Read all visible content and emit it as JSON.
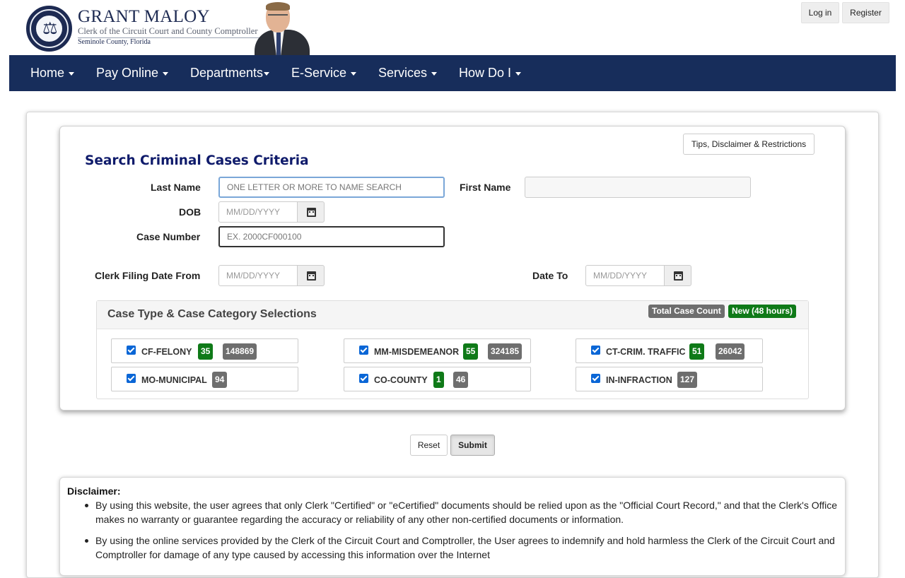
{
  "header": {
    "brand_name": "GRANT MALOY",
    "brand_subtitle": "Clerk of the Circuit Court and County Comptroller",
    "brand_county": "Seminole County, Florida",
    "login_label": "Log in",
    "register_label": "Register",
    "seal_icon": "county-seal-icon"
  },
  "nav": {
    "items": [
      {
        "label": "Home"
      },
      {
        "label": "Pay Online"
      },
      {
        "label": "Departments"
      },
      {
        "label": "E-Service"
      },
      {
        "label": "Services"
      },
      {
        "label": "How Do I"
      }
    ],
    "background": "#172d5b"
  },
  "form": {
    "tips_label": "Tips, Disclaimer & Restrictions",
    "title": "Search Criminal Cases Criteria",
    "last_name_label": "Last Name",
    "last_name_placeholder": "ONE LETTER OR MORE TO NAME SEARCH",
    "first_name_label": "First Name",
    "first_name_value": "",
    "dob_label": "DOB",
    "dob_placeholder": "MM/DD/YYYY",
    "case_number_label": "Case Number",
    "case_number_placeholder": "EX. 2000CF000100",
    "filing_from_label": "Clerk Filing Date From",
    "filing_from_placeholder": "MM/DD/YYYY",
    "date_to_label": "Date To",
    "date_to_placeholder": "MM/DD/YYYY",
    "title_color": "#0f1b6b"
  },
  "case_types": {
    "title": "Case Type & Case Category Selections",
    "total_badge": "Total Case Count",
    "new_badge": "New (48 hours)",
    "items": [
      {
        "label": "CF-FELONY",
        "checked": true,
        "new": "35",
        "total": "148869"
      },
      {
        "label": "MM-MISDEMEANOR",
        "checked": true,
        "new": "55",
        "total": "324185"
      },
      {
        "label": "CT-CRIM. TRAFFIC",
        "checked": true,
        "new": "51",
        "total": "26042"
      },
      {
        "label": "MO-MUNICIPAL",
        "checked": true,
        "new": "",
        "total": "94"
      },
      {
        "label": "CO-COUNTY",
        "checked": true,
        "new": "1",
        "total": "46"
      },
      {
        "label": "IN-INFRACTION",
        "checked": true,
        "new": "",
        "total": "127"
      }
    ],
    "green": "#0f7a18",
    "grey": "#6e6e6e"
  },
  "actions": {
    "reset_label": "Reset",
    "submit_label": "Submit"
  },
  "disclaimer": {
    "title": "Disclaimer:",
    "items": [
      {
        "line1": "By using this website, the user agrees that only Clerk \"Certified\" or \"eCertified\" documents should be relied upon as the \"Official Court Record,\" and that the Clerk's Office",
        "line2": "makes no warranty or guarantee regarding the accuracy or reliability of any other non-certified documents or information."
      },
      {
        "line1": "By using the online services provided by the Clerk of the Circuit Court and Comptroller, the User agrees to indemnify and hold harmless the Clerk of the Circuit Court and",
        "line2": "Comptroller for damage of any type caused by accessing this information over the Internet"
      }
    ]
  }
}
